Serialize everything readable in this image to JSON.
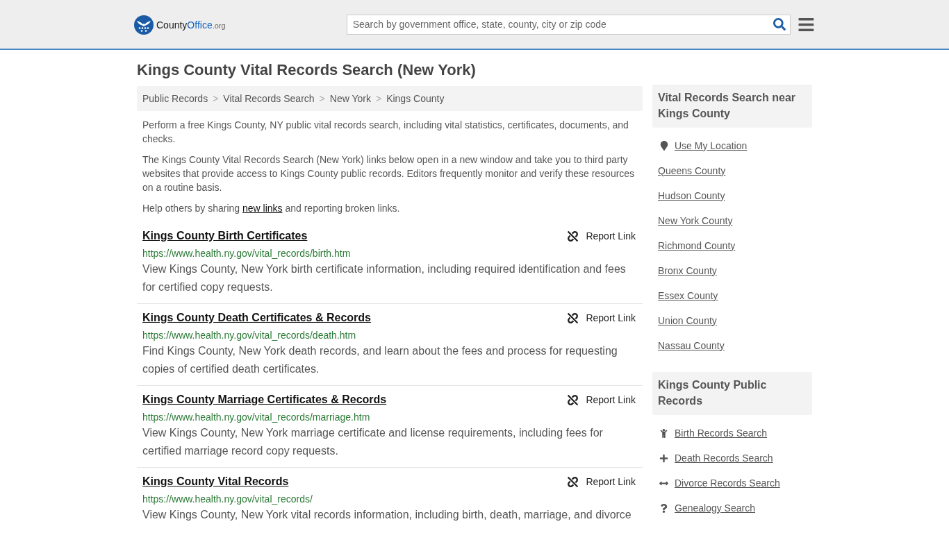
{
  "header": {
    "logo": {
      "name_a": "County",
      "name_b": "Office",
      "suffix": ".org"
    },
    "search": {
      "placeholder": "Search by government office, state, county, city or zip code"
    }
  },
  "page_title": "Kings County Vital Records Search (New York)",
  "breadcrumb": {
    "separator": ">",
    "items": [
      "Public Records",
      "Vital Records Search",
      "New York",
      "Kings County"
    ]
  },
  "intro": {
    "paragraphs": [
      "Perform a free Kings County, NY public vital records search, including vital statistics, certificates, documents, and checks.",
      "The Kings County Vital Records Search (New York) links below open in a new window and take you to third party websites that provide access to Kings County public records. Editors frequently monitor and verify these resources on a routine basis."
    ],
    "share_note": {
      "before": "Help others by sharing ",
      "link": "new links",
      "after": " and reporting broken links."
    }
  },
  "records": [
    {
      "title": "Kings County Birth Certificates",
      "url": "https://www.health.ny.gov/vital_records/birth.htm",
      "description": "View Kings County, New York birth certificate information, including required identification and fees for certified copy requests.",
      "action": "Report Link"
    },
    {
      "title": "Kings County Death Certificates & Records",
      "url": "https://www.health.ny.gov/vital_records/death.htm",
      "description": "Find Kings County, New York death records, and learn about the fees and process for requesting copies of certified death certificates.",
      "action": "Report Link"
    },
    {
      "title": "Kings County Marriage Certificates & Records",
      "url": "https://www.health.ny.gov/vital_records/marriage.htm",
      "description": "View Kings County, New York marriage certificate and license requirements, including fees for certified marriage record copy requests.",
      "action": "Report Link"
    },
    {
      "title": "Kings County Vital Records",
      "url": "https://www.health.ny.gov/vital_records/",
      "description": "View Kings County, New York vital records information, including birth, death, marriage, and divorce",
      "action": "Report Link"
    }
  ],
  "sidebar": {
    "nearby": {
      "title": "Vital Records Search near Kings County",
      "items": [
        {
          "kind": "location",
          "label": "Use My Location"
        },
        {
          "kind": "county",
          "label": "Queens County"
        },
        {
          "kind": "county",
          "label": "Hudson County"
        },
        {
          "kind": "county",
          "label": "New York County"
        },
        {
          "kind": "county",
          "label": "Richmond County"
        },
        {
          "kind": "county",
          "label": "Bronx County"
        },
        {
          "kind": "county",
          "label": "Essex County"
        },
        {
          "kind": "county",
          "label": "Union County"
        },
        {
          "kind": "county",
          "label": "Nassau County"
        }
      ]
    },
    "public_records": {
      "title": "Kings County Public Records",
      "items": [
        {
          "kind": "birth",
          "label": "Birth Records Search"
        },
        {
          "kind": "death",
          "label": "Death Records Search"
        },
        {
          "kind": "divorce",
          "label": "Divorce Records Search"
        },
        {
          "kind": "genealogy",
          "label": "Genealogy Search"
        }
      ]
    }
  }
}
